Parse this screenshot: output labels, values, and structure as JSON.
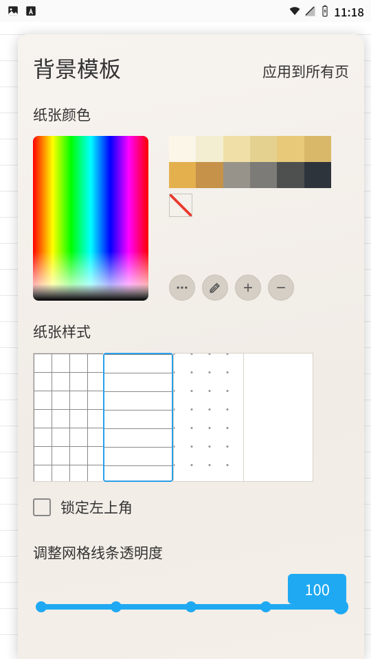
{
  "status": {
    "time": "11:18"
  },
  "panel": {
    "title": "背景模板",
    "apply_all": "应用到所有页",
    "paper_color_label": "纸张颜色",
    "swatches": [
      "#fbf6e8",
      "#f3eed2",
      "#f0e0a8",
      "#e5d18f",
      "#e8c97a",
      "#d9b86a",
      "#e4b04e",
      "#c6924a",
      "#98938a",
      "#7c7b77",
      "#4e4f4f",
      "#2e343c"
    ],
    "paper_style_label": "纸张样式",
    "styles": [
      "grid",
      "ruled",
      "dots",
      "blank"
    ],
    "selected_style_index": 1,
    "lock_label": "锁定左上角",
    "lock_checked": false,
    "opacity_label": "调整网格线条透明度",
    "opacity_value": "100"
  }
}
